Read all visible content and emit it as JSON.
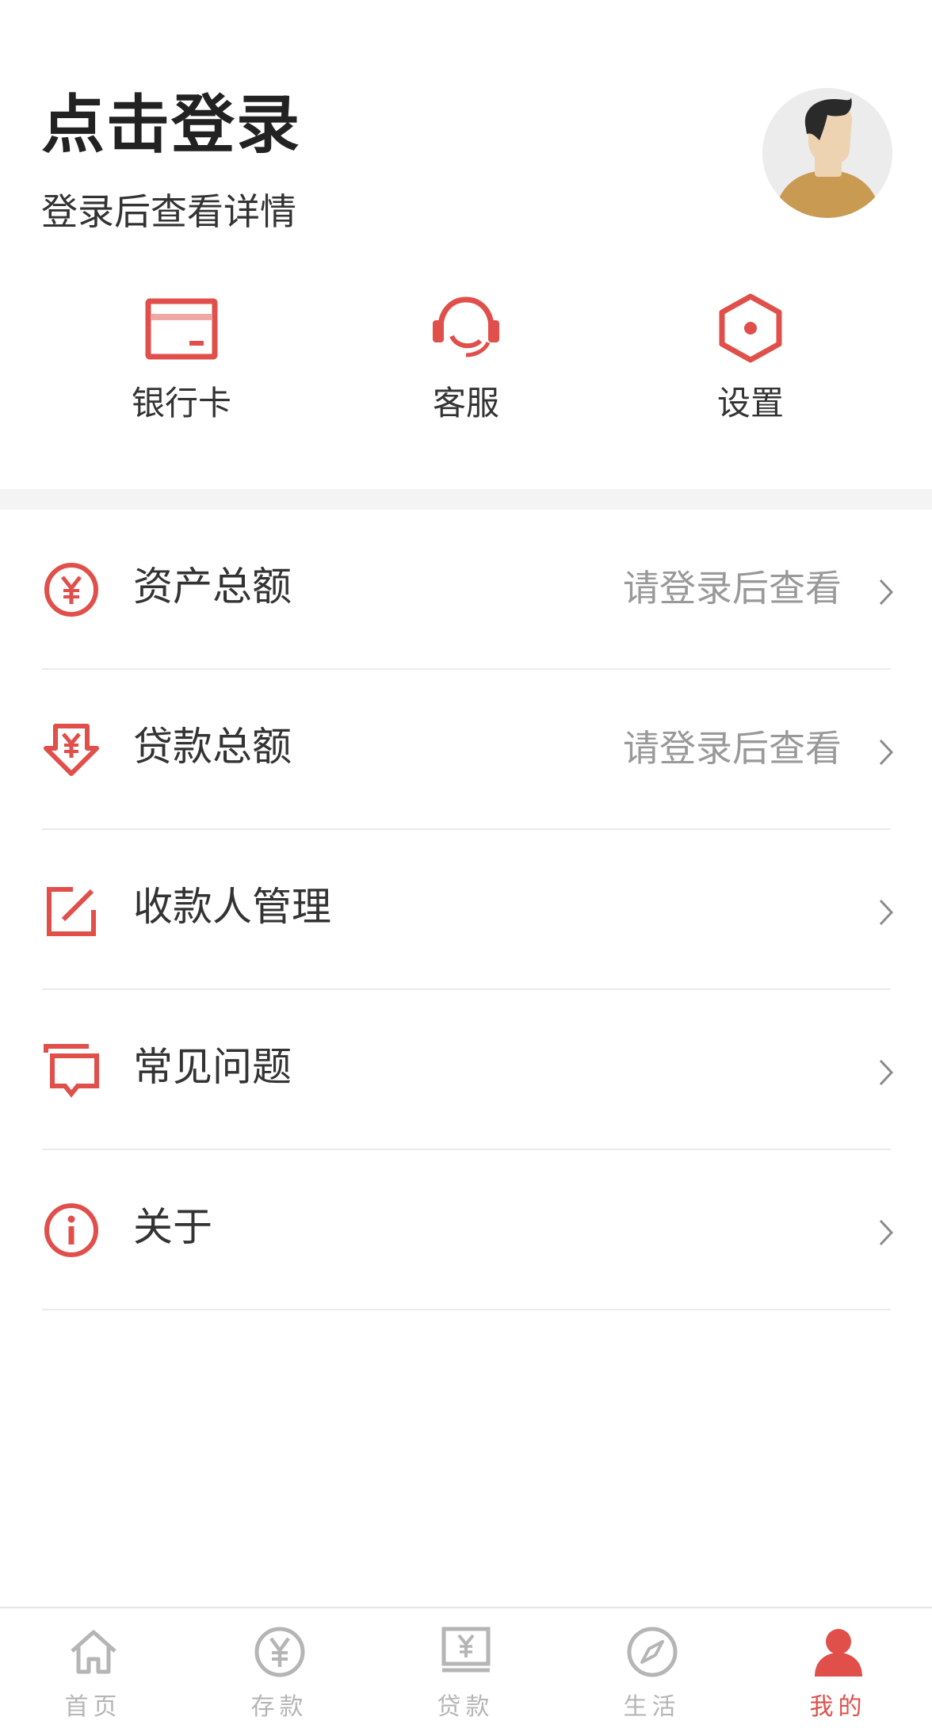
{
  "header": {
    "login_title": "点击登录",
    "login_subtitle": "登录后查看详情"
  },
  "quick_actions": [
    {
      "label": "银行卡",
      "icon": "bank-card-icon"
    },
    {
      "label": "客服",
      "icon": "headset-icon"
    },
    {
      "label": "设置",
      "icon": "settings-hexagon-icon"
    }
  ],
  "menu": [
    {
      "label": "资产总额",
      "value": "请登录后查看",
      "icon": "yen-circle-icon"
    },
    {
      "label": "贷款总额",
      "value": "请登录后查看",
      "icon": "yen-download-icon"
    },
    {
      "label": "收款人管理",
      "value": "",
      "icon": "edit-square-icon"
    },
    {
      "label": "常见问题",
      "value": "",
      "icon": "chat-bubble-icon"
    },
    {
      "label": "关于",
      "value": "",
      "icon": "info-circle-icon"
    }
  ],
  "tabbar": {
    "items": [
      {
        "label": "首页",
        "icon": "home-icon",
        "active": false
      },
      {
        "label": "存款",
        "icon": "yen-circle-icon",
        "active": false
      },
      {
        "label": "贷款",
        "icon": "loan-monitor-icon",
        "active": false
      },
      {
        "label": "生活",
        "icon": "compass-icon",
        "active": false
      },
      {
        "label": "我的",
        "icon": "user-icon",
        "active": true
      }
    ]
  },
  "colors": {
    "accent": "#e04f4a",
    "text_primary": "#333333",
    "text_secondary": "#999999",
    "tab_inactive": "#b5b5b5",
    "divider": "#f4f4f4"
  }
}
